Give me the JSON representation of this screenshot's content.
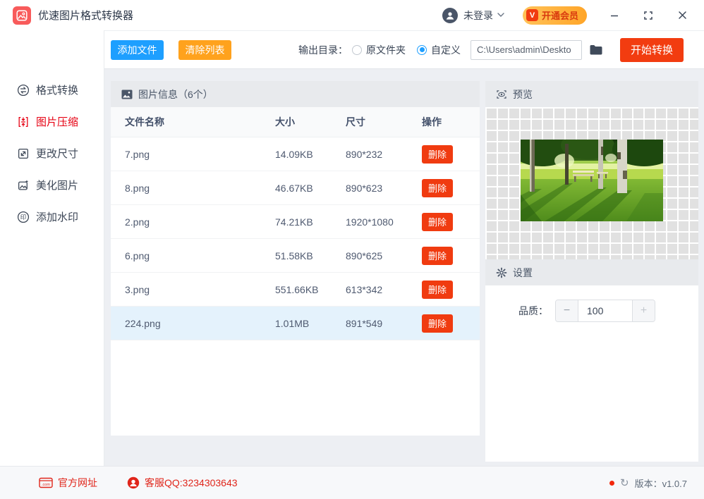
{
  "window": {
    "title": "优速图片格式转换器",
    "user_label": "未登录",
    "vip_label": "开通会员",
    "vip_badge": "V"
  },
  "toolbar": {
    "add_files_label": "添加文件",
    "clear_list_label": "清除列表",
    "output_dir_label": "输出目录：",
    "radio_original_label": "原文件夹",
    "radio_custom_label": "自定义",
    "path_value": "C:\\Users\\admin\\Deskto",
    "start_label": "开始转换"
  },
  "sidebar": {
    "items": [
      {
        "label": "格式转换",
        "active": false
      },
      {
        "label": "图片压缩",
        "active": true
      },
      {
        "label": "更改尺寸",
        "active": false
      },
      {
        "label": "美化图片",
        "active": false
      },
      {
        "label": "添加水印",
        "active": false
      }
    ]
  },
  "file_panel": {
    "title": "图片信息（6个）",
    "columns": [
      "文件名称",
      "大小",
      "尺寸",
      "操作"
    ],
    "delete_label": "删除",
    "rows": [
      {
        "name": "7.png",
        "size": "14.09KB",
        "dims": "890*232",
        "selected": false
      },
      {
        "name": "8.png",
        "size": "46.67KB",
        "dims": "890*623",
        "selected": false
      },
      {
        "name": "2.png",
        "size": "74.21KB",
        "dims": "1920*1080",
        "selected": false
      },
      {
        "name": "6.png",
        "size": "51.58KB",
        "dims": "890*625",
        "selected": false
      },
      {
        "name": "3.png",
        "size": "551.66KB",
        "dims": "613*342",
        "selected": false
      },
      {
        "name": "224.png",
        "size": "1.01MB",
        "dims": "891*549",
        "selected": true
      }
    ]
  },
  "preview_panel": {
    "title": "预览"
  },
  "settings_panel": {
    "title": "设置",
    "quality_label": "品质：",
    "quality_value": "100",
    "minus_label": "−",
    "plus_label": "+"
  },
  "footer": {
    "website_label": "官方网址",
    "website_icon_text": ".com",
    "service_label": "客服QQ:3234303643",
    "refresh_glyph": "↻",
    "version_label": "版本：v1.0.7"
  },
  "colors": {
    "accent_blue": "#1e9fff",
    "accent_orange": "#ffa21d",
    "accent_red": "#f23c10",
    "sidebar_active_red": "#e60012",
    "footer_red": "#e0251a",
    "selected_row_bg": "#e4f2fc",
    "vip_gradient_start": "#ffc258",
    "vip_gradient_end": "#ffa528"
  }
}
